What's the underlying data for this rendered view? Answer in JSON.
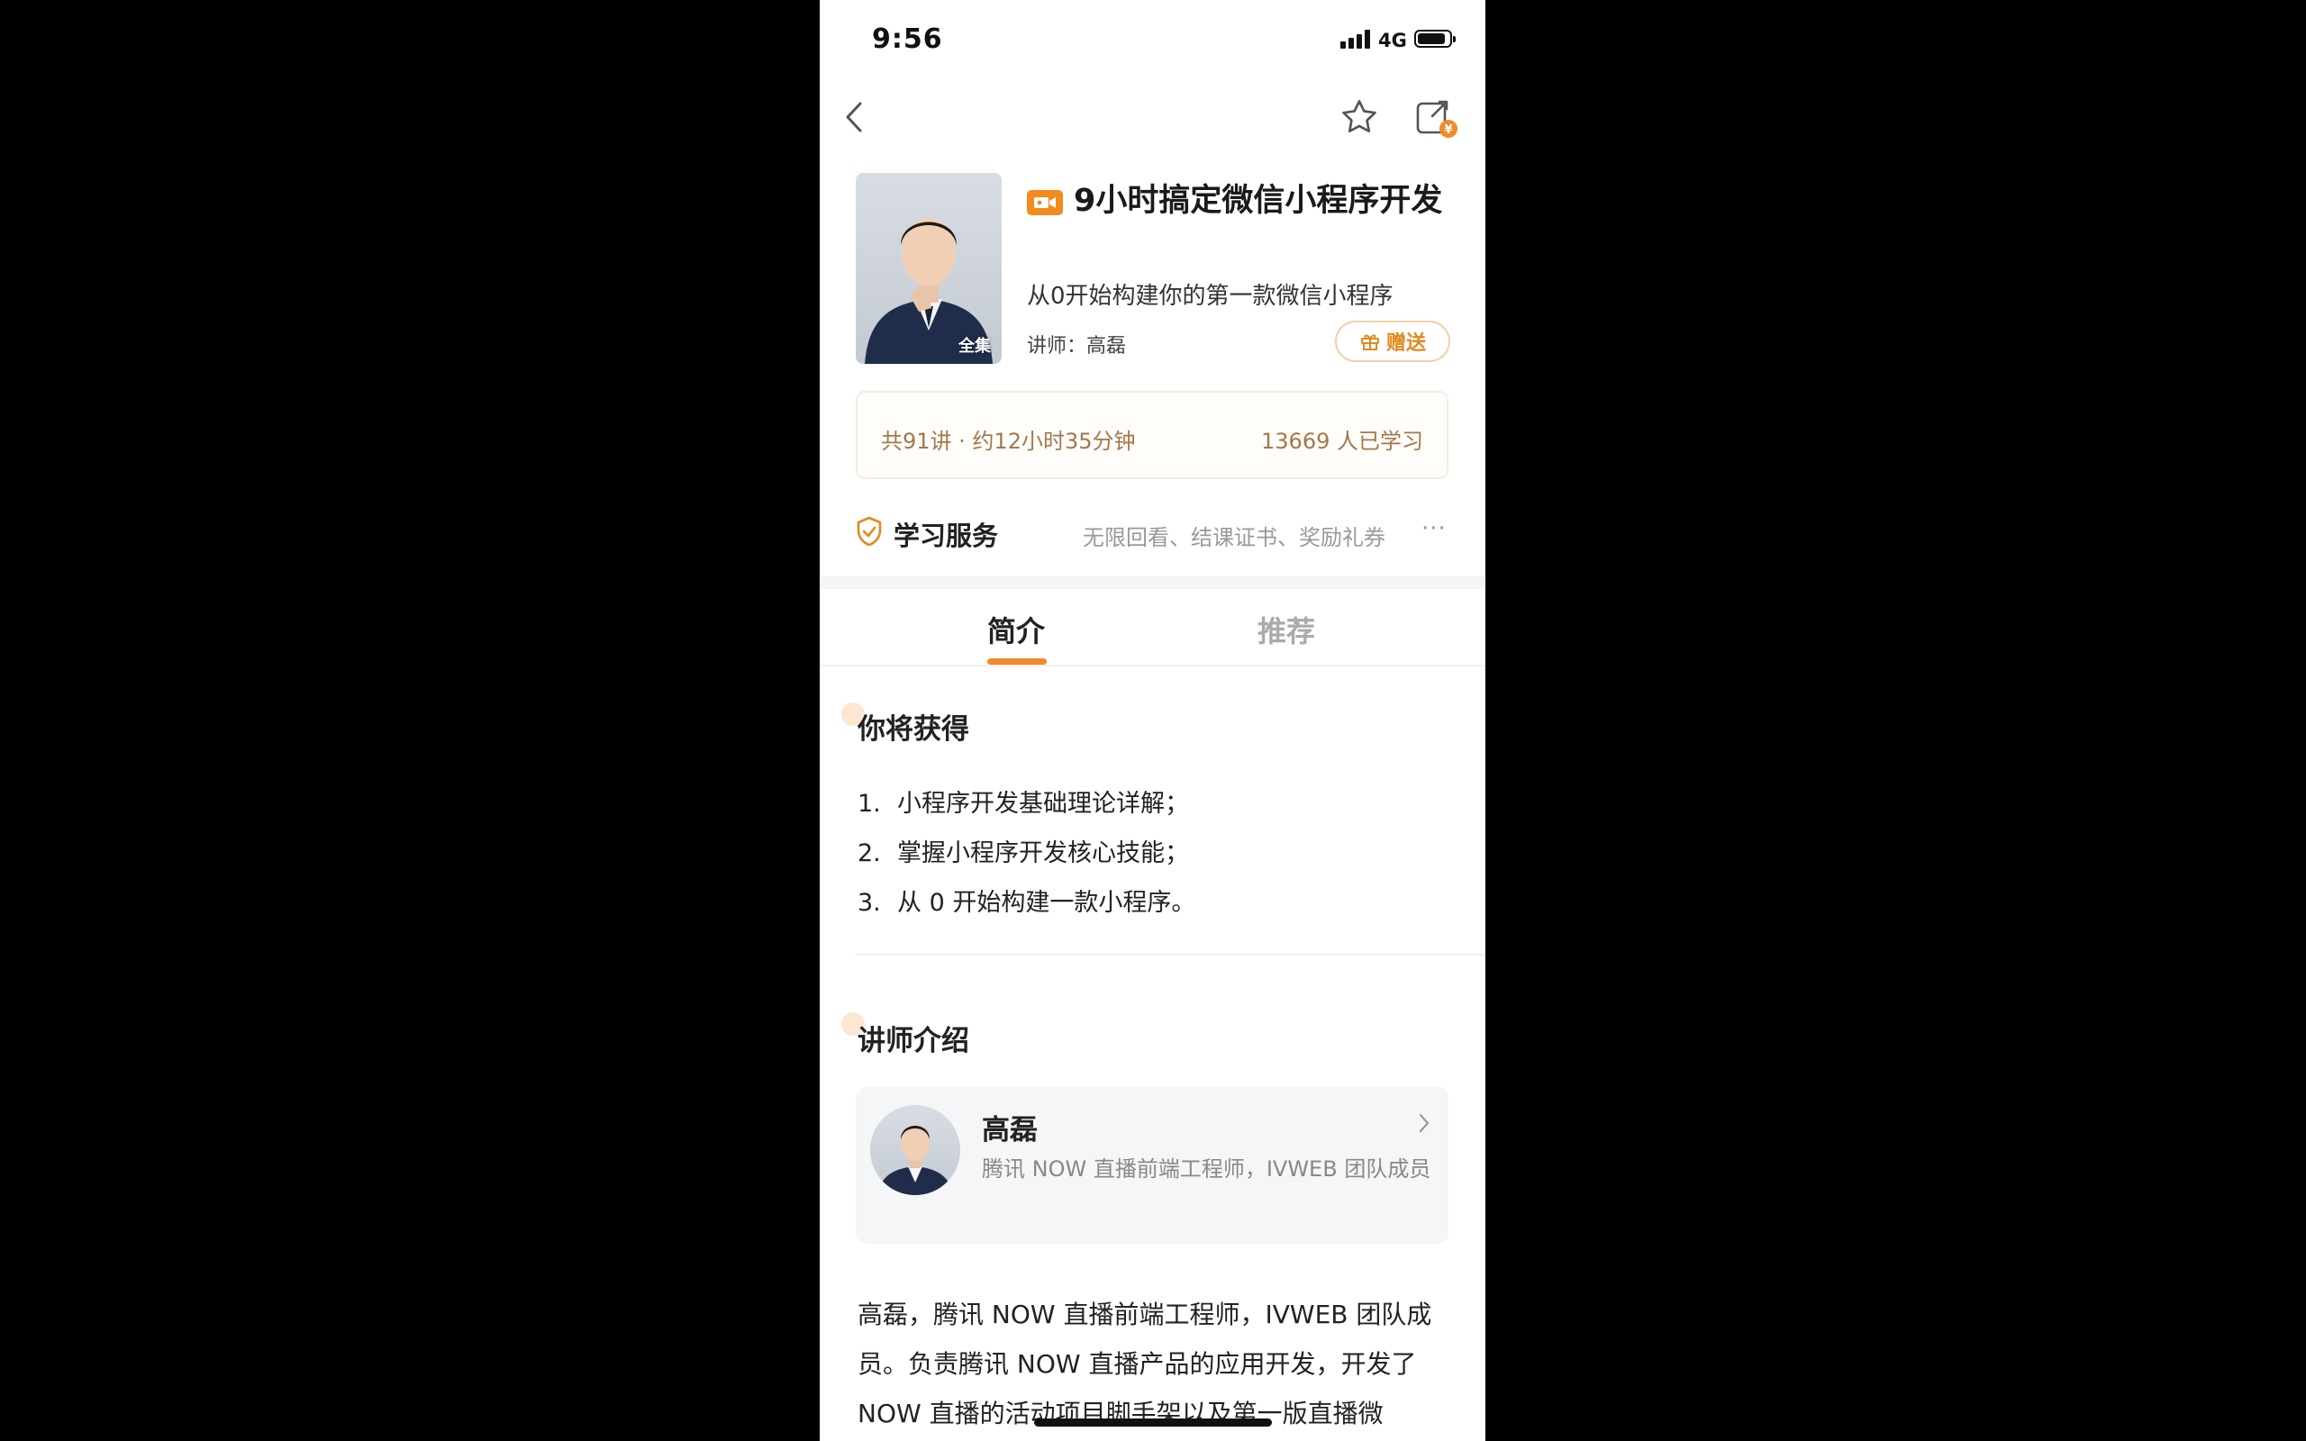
{
  "status_bar": {
    "time": "9:56",
    "network": "4G"
  },
  "header": {
    "back_icon": "chevron-left-icon",
    "favorite_icon": "star-icon",
    "share_icon": "share-coin-icon"
  },
  "course": {
    "cover_tag": "全集",
    "title": "9小时搞定微信小程序开发",
    "subtitle": "从0开始构建你的第一款微信小程序",
    "lecturer": "讲师：高磊",
    "gift_label": "赠送",
    "stats_left": "共91讲 · 约12小时35分钟",
    "stats_right": "13669 人已学习"
  },
  "service": {
    "title": "学习服务",
    "desc": "无限回看、结课证书、奖励礼券",
    "more": "···"
  },
  "tabs": [
    {
      "label": "简介"
    },
    {
      "label": "推荐"
    }
  ],
  "gains": {
    "title": "你将获得",
    "items": [
      {
        "num": "1.",
        "text": "小程序开发基础理论详解；"
      },
      {
        "num": "2.",
        "text": "掌握小程序开发核心技能；"
      },
      {
        "num": "3.",
        "text": "从 0 开始构建一款小程序。"
      }
    ]
  },
  "teacher": {
    "section_title": "讲师介绍",
    "name": "高磊",
    "desc": "腾讯 NOW 直播前端工程师，IVWEB 团队成员",
    "bio": "高磊，腾讯 NOW 直播前端工程师，IVWEB 团队成员。负责腾讯 NOW 直播产品的应用开发，开发了 NOW 直播的活动项目脚手架以及第一版直播微"
  },
  "colors": {
    "accent": "#f08a2b",
    "stats_text": "#a2784b"
  }
}
